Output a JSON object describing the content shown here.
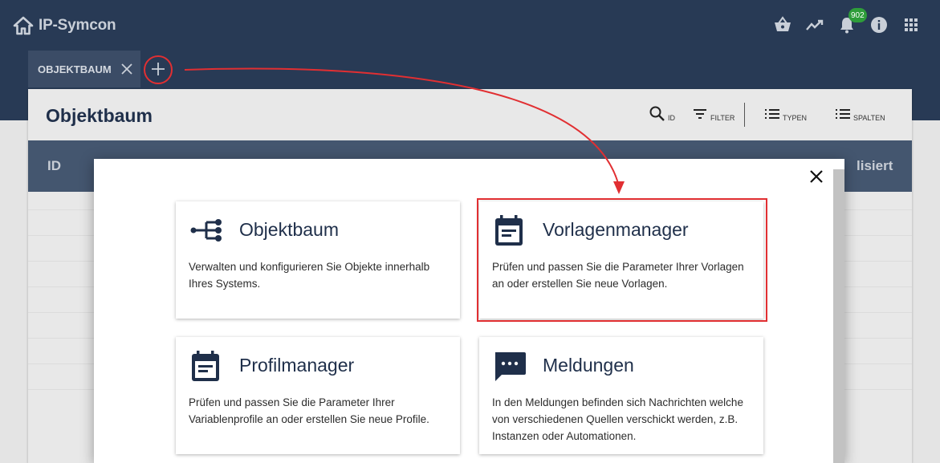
{
  "app": {
    "title": "IP-Symcon"
  },
  "header": {
    "icons": [
      "home-icon",
      "basket-icon",
      "trend-icon",
      "bell-icon",
      "info-icon",
      "apps-grid-icon"
    ],
    "notification_count": "902",
    "badge_color": "#2e9d3a"
  },
  "tabs": [
    {
      "label": "OBJEKTBAUM"
    }
  ],
  "panel": {
    "title": "Objektbaum",
    "tools": [
      {
        "icon": "search-icon",
        "label": "ID"
      },
      {
        "icon": "filter-icon",
        "label": "FILTER"
      },
      {
        "icon": "list-icon",
        "label": "TYPEN"
      },
      {
        "icon": "list-icon",
        "label": "SPALTEN"
      }
    ],
    "columns": [
      "ID",
      "lisiert"
    ]
  },
  "modal": {
    "cards": [
      {
        "icon": "tree-icon",
        "title": "Objektbaum",
        "description": "Verwalten und konfigurieren Sie Objekte innerhalb Ihres Systems."
      },
      {
        "icon": "calendar-icon",
        "title": "Vorlagenmanager",
        "description": "Prüfen und passen Sie die Parameter Ihrer Vorlagen an oder erstellen Sie neue Vorlagen."
      },
      {
        "icon": "calendar-icon",
        "title": "Profilmanager",
        "description": "Prüfen und passen Sie die Parameter Ihrer Variablenprofile an oder erstellen Sie neue Profile."
      },
      {
        "icon": "message-icon",
        "title": "Meldungen",
        "description": "In den Meldungen befinden sich Nachrichten welche von verschiedenen Quellen verschickt werden, z.B. Instanzen oder Automationen."
      }
    ]
  },
  "colors": {
    "header_bg": "#283a55",
    "accent_dark": "#1f2f4a",
    "annotation_red": "#e12f32"
  }
}
